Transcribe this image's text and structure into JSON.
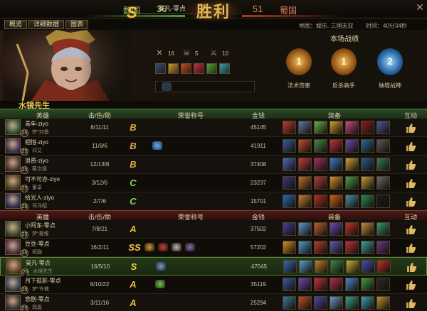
{
  "score": {
    "left_faction": "魏国",
    "left_score": "36",
    "emblem": "胜利",
    "right_score": "51",
    "right_faction": "蜀国"
  },
  "tabs": [
    "概览",
    "详细数据",
    "图表"
  ],
  "map_info": "地图：娱乐. 三国无双",
  "time_info": "时间：40分34秒",
  "hero": {
    "rank": "S",
    "name": "昊凡-零点",
    "kills": "16",
    "deaths": "5",
    "assists": "10"
  },
  "record": {
    "title": "本场战绩",
    "medals": [
      {
        "label": "法术伤害",
        "number": "1",
        "color": "#d09a3a"
      },
      {
        "label": "反杀高手",
        "number": "1",
        "color": "#d09a3a"
      },
      {
        "label": "铀塔战神",
        "number": "2",
        "color": "#5aa0d8"
      }
    ]
  },
  "team1": {
    "name": "水镜先生",
    "headers": {
      "hero": "英雄",
      "kda": "击/伤/助",
      "honor": "荣誉称号",
      "gold": "金钱",
      "equip": "装备",
      "interact": "互动"
    },
    "rows": [
      {
        "player": "青年-ziyo",
        "level": "25",
        "hero": "梦*刘备",
        "kda": "8/11/11",
        "grade": "B",
        "gold": "45145",
        "avatar": "#3a5a3a"
      },
      {
        "player": "相惜-ziyo",
        "level": "25",
        "hero": "邓艾",
        "kda": "11/8/6",
        "grade": "B",
        "gold": "41911",
        "avatar": "#4a3a5a"
      },
      {
        "player": "浪费-ziyo",
        "level": "25",
        "hero": "蔡文姬",
        "kda": "12/13/8",
        "grade": "B",
        "gold": "37408",
        "avatar": "#5a3a3a"
      },
      {
        "player": "可不可亦-ziyo",
        "level": "25",
        "hero": "董卓",
        "kda": "3/12/6",
        "grade": "C",
        "gold": "23237",
        "avatar": "#5a4a2a"
      },
      {
        "player": "拾光人-ziyo",
        "level": "25",
        "hero": "司马昭",
        "kda": "2/7/6",
        "grade": "C",
        "gold": "15701",
        "avatar": "#3a3a5a"
      }
    ]
  },
  "team2": {
    "headers": {
      "hero": "英雄",
      "kda": "击/伤/助",
      "honor": "荣誉称号",
      "gold": "金钱",
      "equip": "装备",
      "interact": "互动"
    },
    "rows": [
      {
        "player": "小阿东-零点",
        "level": "25",
        "hero": "梦*姜维",
        "kda": "7/8/21",
        "grade": "A",
        "gold": "37502",
        "avatar": "#4a5a3a"
      },
      {
        "player": "豆豆-零点",
        "level": "25",
        "hero": "祝融",
        "kda": "16/2/11",
        "grade": "SS",
        "gold": "57202",
        "avatar": "#5a3a4a"
      },
      {
        "player": "昊凡-零点",
        "level": "25",
        "hero": "水镜先生",
        "kda": "16/5/10",
        "grade": "S",
        "gold": "47045",
        "avatar": "#6a4a2a"
      },
      {
        "player": "月下孤影-零点",
        "level": "25",
        "hero": "梦*许褚",
        "kda": "8/10/22",
        "grade": "A",
        "gold": "35119",
        "avatar": "#3a4a5a"
      },
      {
        "player": "悲剧-零点",
        "level": "25",
        "hero": "郭嘉",
        "kda": "3/11/16",
        "grade": "A",
        "gold": "25294",
        "avatar": "#4a3a3a"
      }
    ]
  },
  "colors": {
    "grade_S": "#f5c644",
    "grade_A": "#f0b840",
    "grade_B": "#e4a838",
    "grade_C": "#8ccf4a",
    "win_green": "#9bd26b",
    "lose_red": "#e0805a"
  }
}
